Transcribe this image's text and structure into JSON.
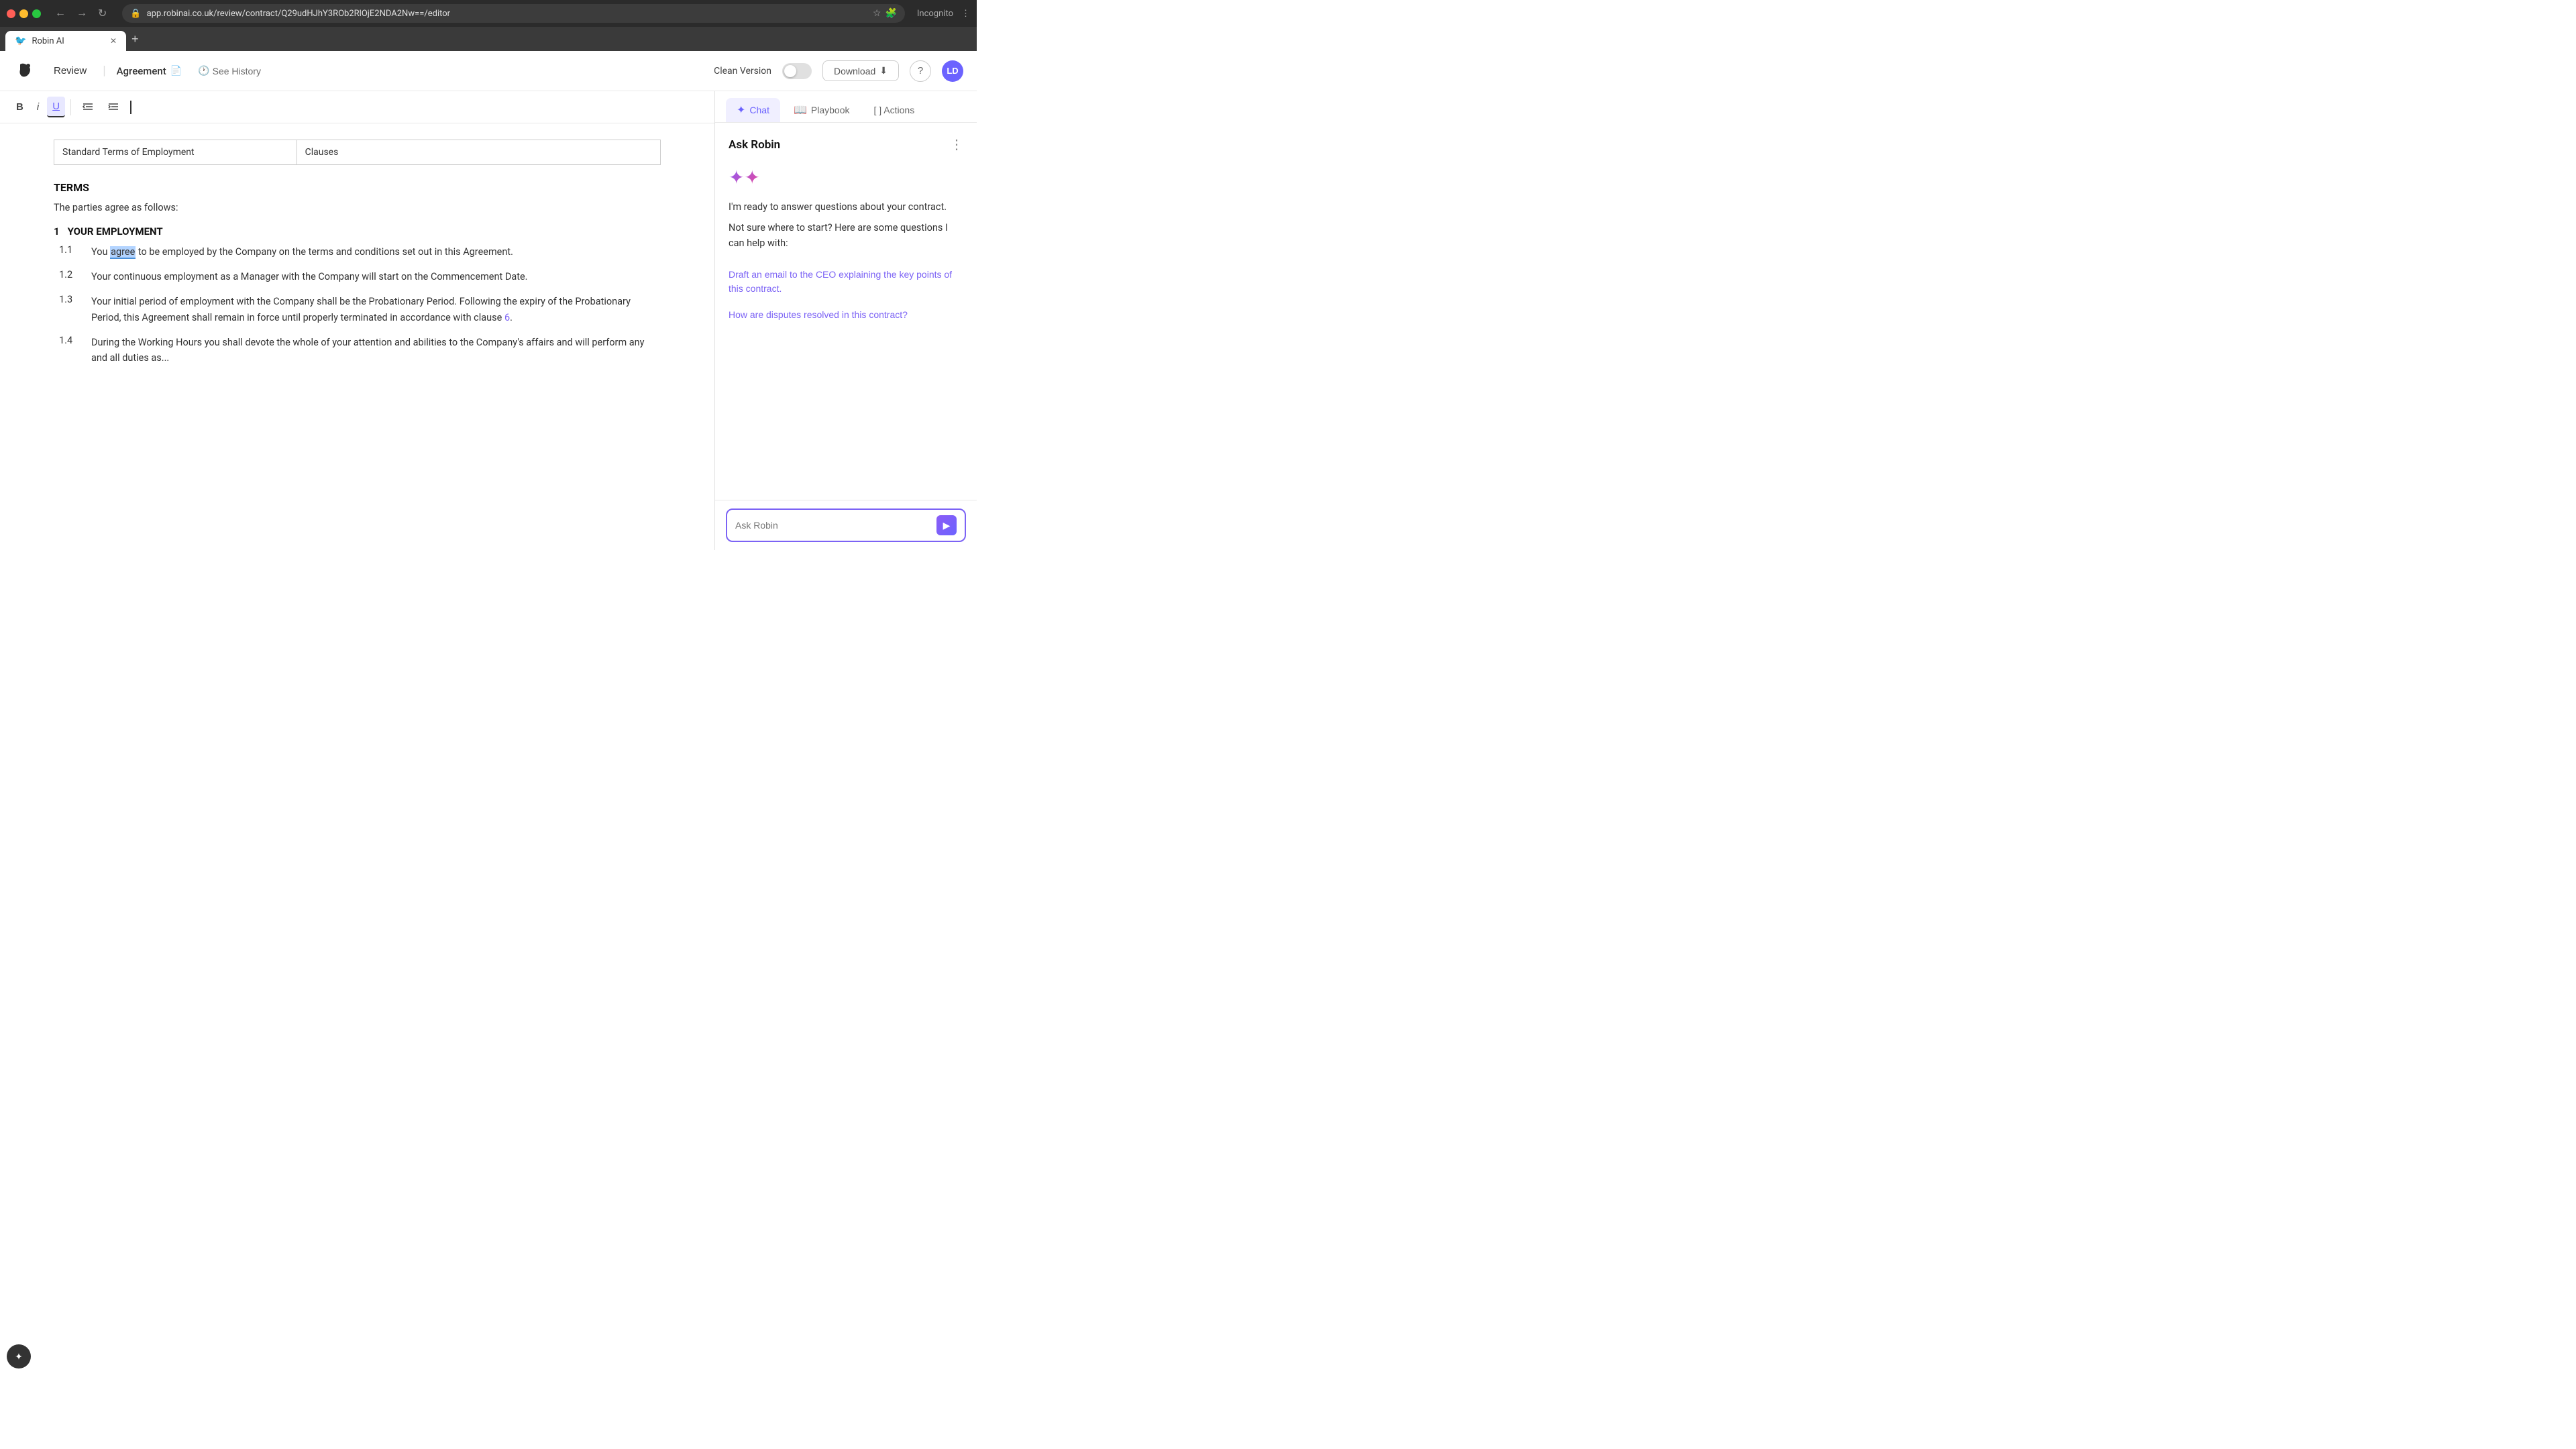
{
  "browser": {
    "url": "app.robinai.co.uk/review/contract/Q29udHJhY3ROb2RlOjE2NDA2Nw==/editor",
    "tab_title": "Robin AI",
    "incognito_label": "Incognito"
  },
  "header": {
    "review_label": "Review",
    "agreement_label": "Agreement",
    "see_history_label": "See History",
    "clean_version_label": "Clean Version",
    "download_label": "Download",
    "help_label": "?",
    "avatar_label": "LD"
  },
  "toolbar": {
    "bold_label": "B",
    "italic_label": "i",
    "underline_label": "U"
  },
  "document": {
    "table_col1": "Standard Terms of Employment",
    "table_col2": "Clauses",
    "section_title": "TERMS",
    "intro_text": "The parties agree as follows:",
    "clause1_title": "YOUR EMPLOYMENT",
    "clause1_num": "1",
    "items": [
      {
        "num": "1.1",
        "text_before": "You ",
        "highlight": "agree",
        "text_after": " to be employed by the Company on the terms and conditions set out in this Agreement."
      },
      {
        "num": "1.2",
        "text": "Your continuous employment as a Manager with the Company will start on the Commencement Date."
      },
      {
        "num": "1.3",
        "text_before": "Your initial period of employment with the Company shall be the Probationary Period. Following the expiry of the Probationary Period, this Agreement shall remain in force until properly terminated in accordance with clause ",
        "link": "6",
        "text_after": "."
      },
      {
        "num": "1.4",
        "text": "During the Working Hours you shall devote the whole of your attention and abilities to the Company's affairs and will perform any and all duties as..."
      }
    ]
  },
  "right_panel": {
    "chat_label": "Chat",
    "playbook_label": "Playbook",
    "actions_label": "[ ] Actions",
    "ask_robin_title": "Ask Robin",
    "more_icon": "⋮",
    "robin_intro": "I'm ready to answer questions about your contract.",
    "robin_sub": "Not sure where to start? Here are some questions I can help with:",
    "suggested_links": [
      "Draft an email to the CEO explaining the key points of this contract.",
      "How are disputes resolved in this contract?"
    ],
    "input_placeholder": "Ask Robin",
    "send_icon": "▶"
  }
}
